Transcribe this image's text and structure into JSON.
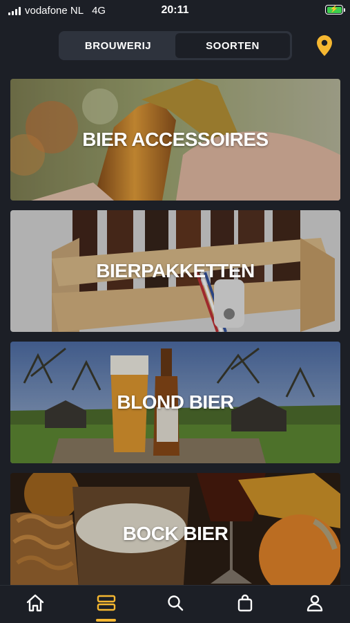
{
  "status_bar": {
    "carrier": "vodafone NL",
    "network": "4G",
    "time": "20:11"
  },
  "segment": {
    "tabs": [
      "BROUWERIJ",
      "SOORTEN"
    ],
    "active_index": 1
  },
  "categories": [
    {
      "label": "BIER ACCESSOIRES"
    },
    {
      "label": "BIERPAKKETTEN"
    },
    {
      "label": "BLOND BIER"
    },
    {
      "label": "BOCK BIER"
    }
  ],
  "bottom_nav": {
    "items": [
      "home-icon",
      "categories-icon",
      "search-icon",
      "shopping-bag-icon",
      "profile-icon"
    ],
    "active_index": 1
  },
  "colors": {
    "accent": "#f5b731",
    "background": "#1c1f26",
    "segment_bg": "#2e333d"
  }
}
